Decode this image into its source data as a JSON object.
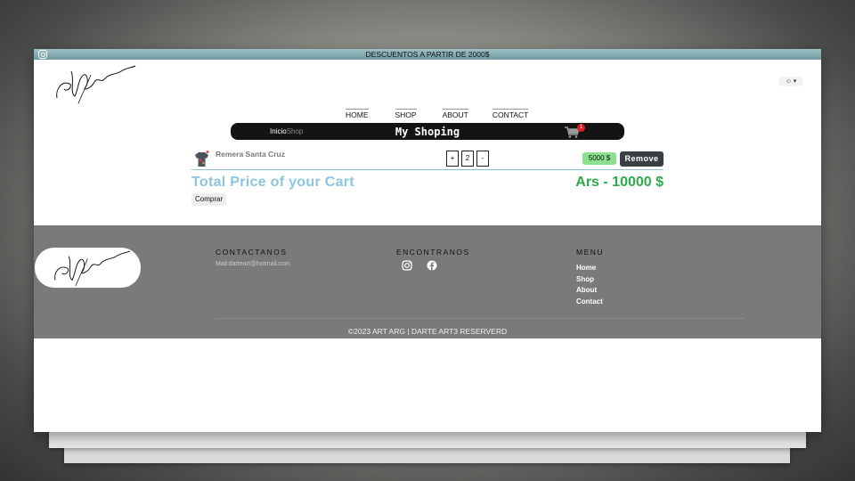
{
  "topbar": {
    "promo": "DESCUENTOS A PARTIR DE 2000$",
    "icon": "instagram-icon"
  },
  "header": {
    "logo": "signature-logo",
    "user_menu_icon": "user-icon"
  },
  "nav": {
    "items": [
      {
        "label": "HOME"
      },
      {
        "label": "SHOP"
      },
      {
        "label": "ABOUT"
      },
      {
        "label": "CONTACT"
      }
    ]
  },
  "shopbar": {
    "crumb_home": "Inicio",
    "crumb_current": "Shop",
    "title": "My Shoping",
    "cart_count": "1"
  },
  "cart": {
    "items": [
      {
        "name": "Remera Santa Cruz",
        "qty_plus": "+",
        "quantity": "2",
        "qty_minus": "-",
        "price": "5000 $",
        "remove_label": "Remove"
      }
    ],
    "total_label": "Total Price of your Cart",
    "total_value": "Ars - 10000 $",
    "buy_label": "Comprar"
  },
  "footer": {
    "contact_title": "CONTACTANOS",
    "contact_mail": "Mail:darteart@hotmail.com",
    "find_title": "ENCONTRANOS",
    "menu_title": "MENU",
    "menu_items": [
      "Home",
      "Shop",
      "About",
      "Contact"
    ],
    "copyright": "©2023 ART ARG | DARTE ART3 RESERVERD"
  },
  "colors": {
    "topbar": "#7fa8ad",
    "shopbar": "#141414",
    "total_label": "#8cc6de",
    "total_value": "#2bab49",
    "price_badge": "#8be08e",
    "remove_button": "#3a3f44",
    "footer": "#7a7a7a",
    "cart_badge": "#e02020"
  }
}
